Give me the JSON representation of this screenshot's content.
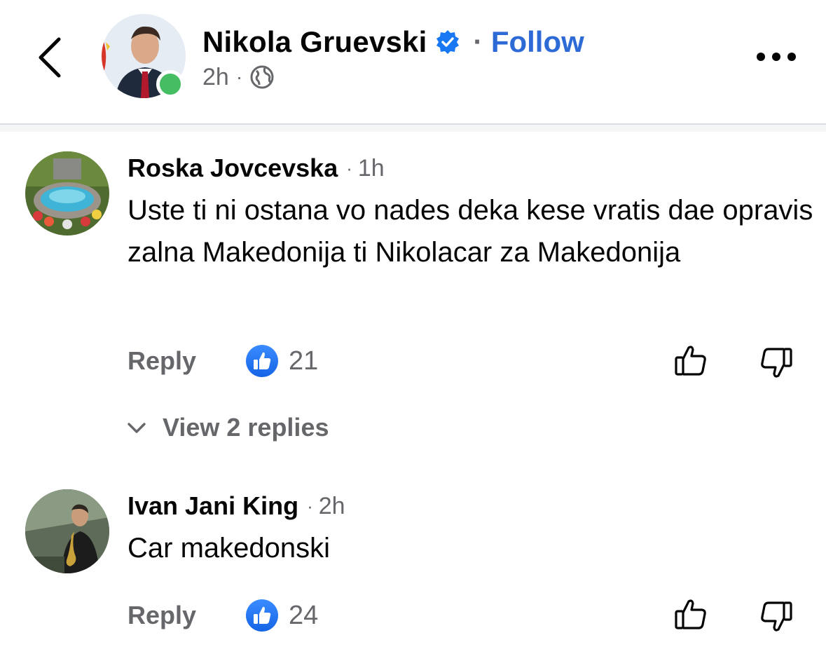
{
  "post_header": {
    "author": "Nikola Gruevski",
    "follow_label": "Follow",
    "time": "2h",
    "separator": "·"
  },
  "comments": [
    {
      "name": "Roska Jovcevska",
      "time": "1h",
      "text": "Uste ti ni ostana vo nades deka kese vratis dae opravis zalna Makedonija ti Nikolacar za Makedonija",
      "reply_label": "Reply",
      "likes": "21",
      "view_replies_label": "View 2 replies"
    },
    {
      "name": "Ivan Jani King",
      "time": "2h",
      "text": "Car makedonski",
      "reply_label": "Reply",
      "likes": "24"
    }
  ],
  "colors": {
    "accent": "#2d6ad6",
    "like_blue": "#1877f2",
    "online_green": "#45bd62",
    "secondary_text": "#65676b",
    "primary_text": "#050505"
  },
  "icons": {
    "back": "chevron-left-icon",
    "verified": "verified-badge-icon",
    "audience": "globe-icon",
    "more": "more-horizontal-icon",
    "like_badge": "thumbs-up-filled-icon",
    "upvote": "thumbs-up-outline-icon",
    "downvote": "thumbs-down-outline-icon",
    "expand": "chevron-down-icon"
  }
}
